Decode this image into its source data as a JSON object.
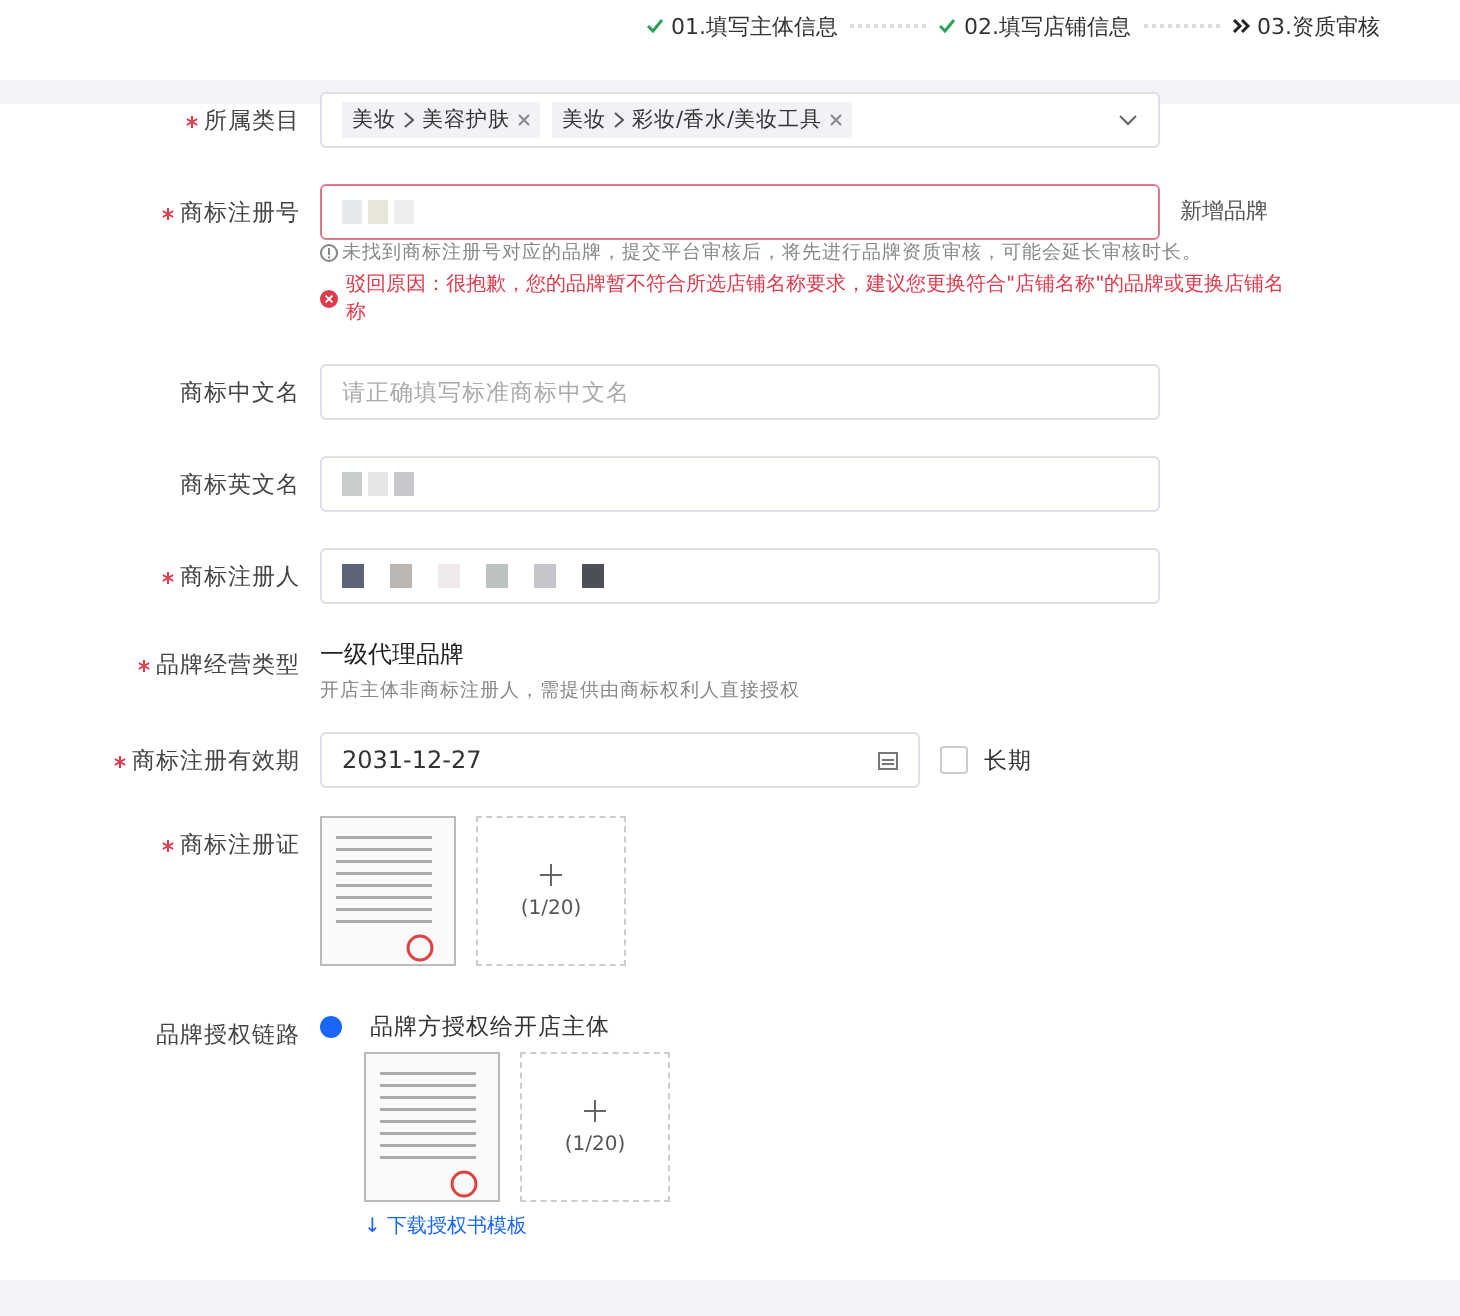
{
  "steps": [
    {
      "label": "01.填写主体信息",
      "kind": "done"
    },
    {
      "label": "02.填写店铺信息",
      "kind": "done"
    },
    {
      "label": "03.资质审核",
      "kind": "current"
    }
  ],
  "form": {
    "category": {
      "label": "所属类目",
      "required": true,
      "tags": [
        {
          "parts": [
            "美妆",
            "美容护肤"
          ]
        },
        {
          "parts": [
            "美妆",
            "彩妆/香水/美妆工具"
          ]
        }
      ]
    },
    "trademark_no": {
      "label": "商标注册号",
      "required": true,
      "error": true,
      "side_link": "新增品牌",
      "hint": "未找到商标注册号对应的品牌，提交平台审核后，将先进行品牌资质审核，可能会延长审核时长。",
      "error_text": "驳回原因：很抱歉，您的品牌暂不符合所选店铺名称要求，建议您更换符合\"店铺名称\"的品牌或更换店铺名称"
    },
    "cn_name": {
      "label": "商标中文名",
      "required": false,
      "placeholder": "请正确填写标准商标中文名"
    },
    "en_name": {
      "label": "商标英文名",
      "required": false
    },
    "registrant": {
      "label": "商标注册人",
      "required": true
    },
    "brand_type": {
      "label": "品牌经营类型",
      "required": true,
      "value": "一级代理品牌",
      "hint": "开店主体非商标注册人，需提供由商标权利人直接授权"
    },
    "validity": {
      "label": "商标注册有效期",
      "required": true,
      "value": "2031-12-27",
      "long_term": {
        "label": "长期",
        "checked": false
      }
    },
    "certificate": {
      "label": "商标注册证",
      "required": true,
      "count": "(1/20)"
    },
    "auth_chain": {
      "label": "品牌授权链路",
      "required": false,
      "option": {
        "label": "品牌方授权给开店主体",
        "selected": true
      },
      "count": "(1/20)",
      "download": "↓ 下载授权书模板"
    }
  }
}
